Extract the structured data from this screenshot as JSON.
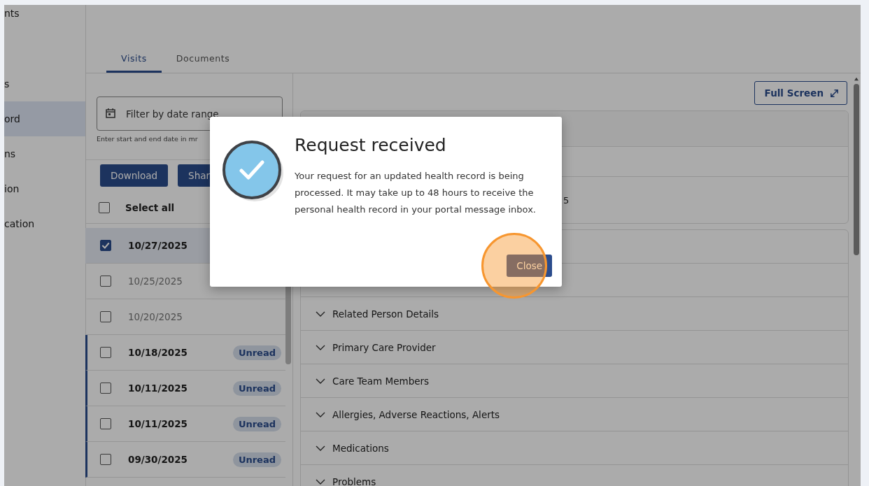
{
  "sidebar": {
    "items": [
      {
        "label": "nts",
        "selected": false
      },
      {
        "label": "s",
        "selected": false
      },
      {
        "label": "ord",
        "selected": true
      },
      {
        "label": "ns",
        "selected": false
      },
      {
        "label": "ion",
        "selected": false
      },
      {
        "label": "cation",
        "selected": false
      }
    ]
  },
  "tabs": [
    {
      "label": "Visits",
      "selected": true
    },
    {
      "label": "Documents",
      "selected": false
    }
  ],
  "filter": {
    "placeholder": "Filter by date range",
    "hint": "Enter start and end date in mr"
  },
  "actions": [
    "Download",
    "Shar"
  ],
  "select_all": {
    "label": "Select all",
    "checked": false
  },
  "visits": [
    {
      "date": "10/27/2025",
      "checked": true,
      "selected": true
    },
    {
      "date": "10/25/2025",
      "checked": false,
      "selected": false
    },
    {
      "date": "10/20/2025",
      "checked": false,
      "selected": false
    },
    {
      "date": "10/18/2025",
      "checked": false,
      "selected": false,
      "badge": "Unread"
    },
    {
      "date": "10/11/2025",
      "checked": false,
      "selected": false,
      "badge": "Unread"
    },
    {
      "date": "10/11/2025",
      "checked": false,
      "selected": false,
      "badge": "Unread"
    },
    {
      "date": "09/30/2025",
      "checked": false,
      "selected": false,
      "badge": "Unread"
    }
  ],
  "full_screen": "Full Screen",
  "summary_fragment": "5",
  "sections": [
    {
      "title": "Related Person Details",
      "expanded": false
    },
    {
      "title": "Primary Care Provider",
      "expanded": false
    },
    {
      "title": "Care Team Members",
      "expanded": false
    },
    {
      "title": "Allergies, Adverse Reactions, Alerts",
      "expanded": false
    },
    {
      "title": "Medications",
      "expanded": false
    },
    {
      "title": "Problems",
      "expanded": false
    }
  ],
  "dialog": {
    "title": "Request received",
    "message": "Your request for an updated health record is being processed. It may take up to 48 hours to receive the personal health record in your portal message inbox.",
    "button": "Close"
  }
}
